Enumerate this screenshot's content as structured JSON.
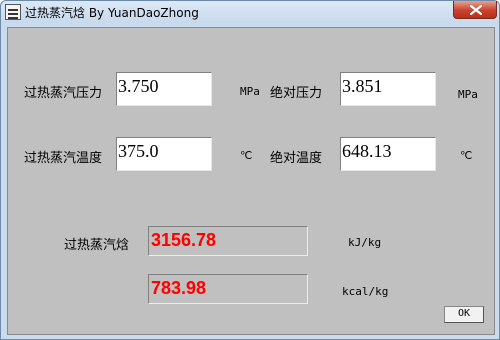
{
  "window": {
    "title": "过热蒸汽焓 By YuanDaoZhong"
  },
  "form": {
    "pressure_label": "过热蒸汽压力",
    "pressure_value": "3.750",
    "pressure_unit": "MPa",
    "abs_pressure_label": "绝对压力",
    "abs_pressure_value": "3.851",
    "abs_pressure_unit": "MPa",
    "temperature_label": "过热蒸汽温度",
    "temperature_value": "375.0",
    "temperature_unit": "℃",
    "abs_temperature_label": "绝对温度",
    "abs_temperature_value": "648.13",
    "abs_temperature_unit": "℃",
    "enthalpy_label": "过热蒸汽焓",
    "enthalpy_kj_value": "3156.78",
    "enthalpy_kj_unit": "kJ/kg",
    "enthalpy_kcal_value": "783.98",
    "enthalpy_kcal_unit": "kcal/kg"
  },
  "buttons": {
    "ok_label": "OK"
  },
  "colors": {
    "result_text": "#ff0000",
    "dialog_face": "#c0c0c0"
  }
}
